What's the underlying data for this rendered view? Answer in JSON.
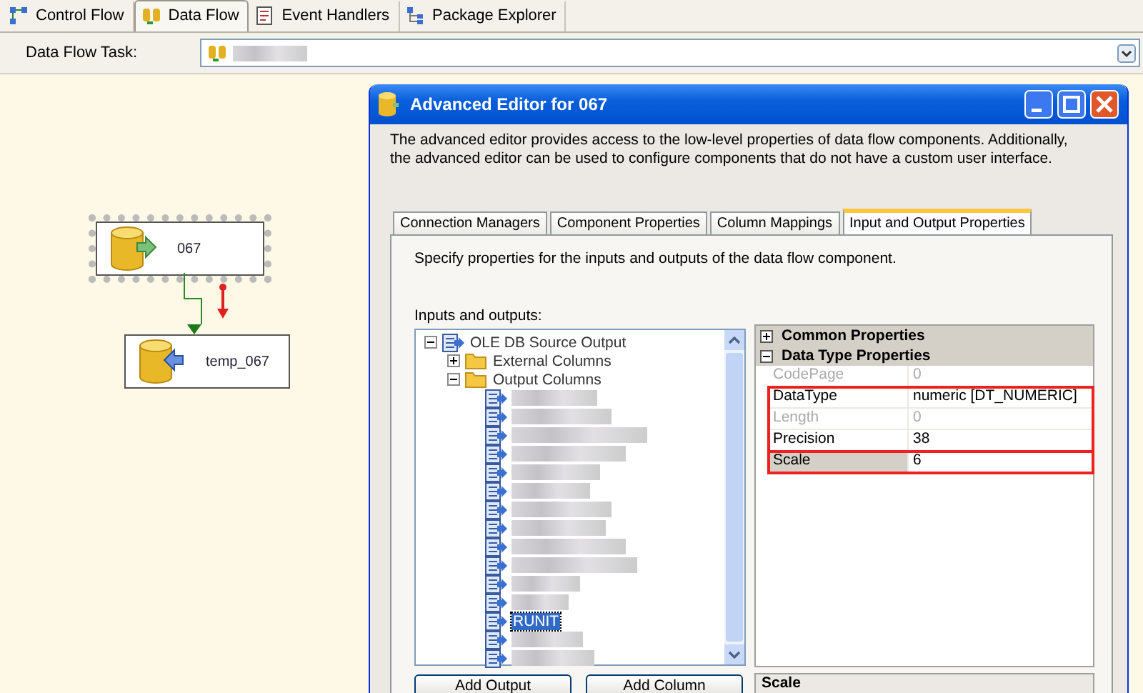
{
  "designer_tabs": [
    {
      "label": "Control Flow",
      "kind": "control",
      "selected": false
    },
    {
      "label": "Data Flow",
      "kind": "dataflow",
      "selected": true
    },
    {
      "label": "Event Handlers",
      "kind": "events",
      "selected": false
    },
    {
      "label": "Package Explorer",
      "kind": "explorer",
      "selected": false
    }
  ],
  "task_row": {
    "label": "Data Flow Task:"
  },
  "canvas": {
    "nodes": [
      {
        "label": "067",
        "kind": "source",
        "selected": true
      },
      {
        "label": "temp_067",
        "kind": "destination",
        "selected": false
      }
    ]
  },
  "dialog": {
    "title": "Advanced Editor for 067",
    "description": "The advanced editor provides access to the low-level properties of data flow components. Additionally, the advanced editor can be used to configure components that do not have a custom user interface.",
    "tabs": [
      {
        "label": "Connection Managers",
        "selected": false
      },
      {
        "label": "Component Properties",
        "selected": false
      },
      {
        "label": "Column Mappings",
        "selected": false
      },
      {
        "label": "Input and Output Properties",
        "selected": true
      }
    ],
    "panel_intro": "Specify properties for the inputs and outputs of the data flow component.",
    "tree_label": "Inputs and outputs:",
    "tree": [
      {
        "label": "OLE DB Source Output",
        "kind": "output",
        "expanded": true,
        "children": [
          {
            "label": "External Columns",
            "kind": "folder",
            "expanded": false
          },
          {
            "label": "Output Columns",
            "kind": "folder",
            "expanded": true,
            "columns": [
              {
                "kind": "redacted",
                "selected": false
              },
              {
                "kind": "redacted",
                "selected": false
              },
              {
                "kind": "redacted",
                "selected": false
              },
              {
                "kind": "redacted",
                "selected": false
              },
              {
                "kind": "redacted",
                "selected": false
              },
              {
                "kind": "redacted",
                "selected": false
              },
              {
                "kind": "redacted",
                "selected": false
              },
              {
                "kind": "redacted",
                "selected": false
              },
              {
                "kind": "redacted",
                "selected": false
              },
              {
                "kind": "redacted",
                "selected": false
              },
              {
                "kind": "redacted",
                "selected": false
              },
              {
                "kind": "redacted",
                "selected": false
              },
              {
                "kind": "named",
                "label": "RUNIT",
                "selected": true
              },
              {
                "kind": "redacted",
                "selected": false
              },
              {
                "kind": "redacted",
                "selected": false
              }
            ]
          }
        ]
      }
    ],
    "categories": [
      {
        "label": "Common Properties",
        "expanded": false
      },
      {
        "label": "Data Type Properties",
        "expanded": true,
        "groups": [
          {
            "highlighted": false,
            "rows": [
              {
                "name": "CodePage",
                "value": "0",
                "disabled": true,
                "selected": false
              }
            ]
          },
          {
            "highlighted": true,
            "rows": [
              {
                "name": "DataType",
                "value": "numeric [DT_NUMERIC]",
                "disabled": false,
                "selected": false
              },
              {
                "name": "Length",
                "value": "0",
                "disabled": true,
                "selected": false
              },
              {
                "name": "Precision",
                "value": "38",
                "disabled": false,
                "selected": false
              }
            ]
          },
          {
            "highlighted": true,
            "rows": [
              {
                "name": "Scale",
                "value": "6",
                "disabled": false,
                "selected": true
              }
            ]
          }
        ]
      }
    ],
    "property_description": "Scale",
    "buttons": [
      "Add Output",
      "Add Column"
    ]
  }
}
